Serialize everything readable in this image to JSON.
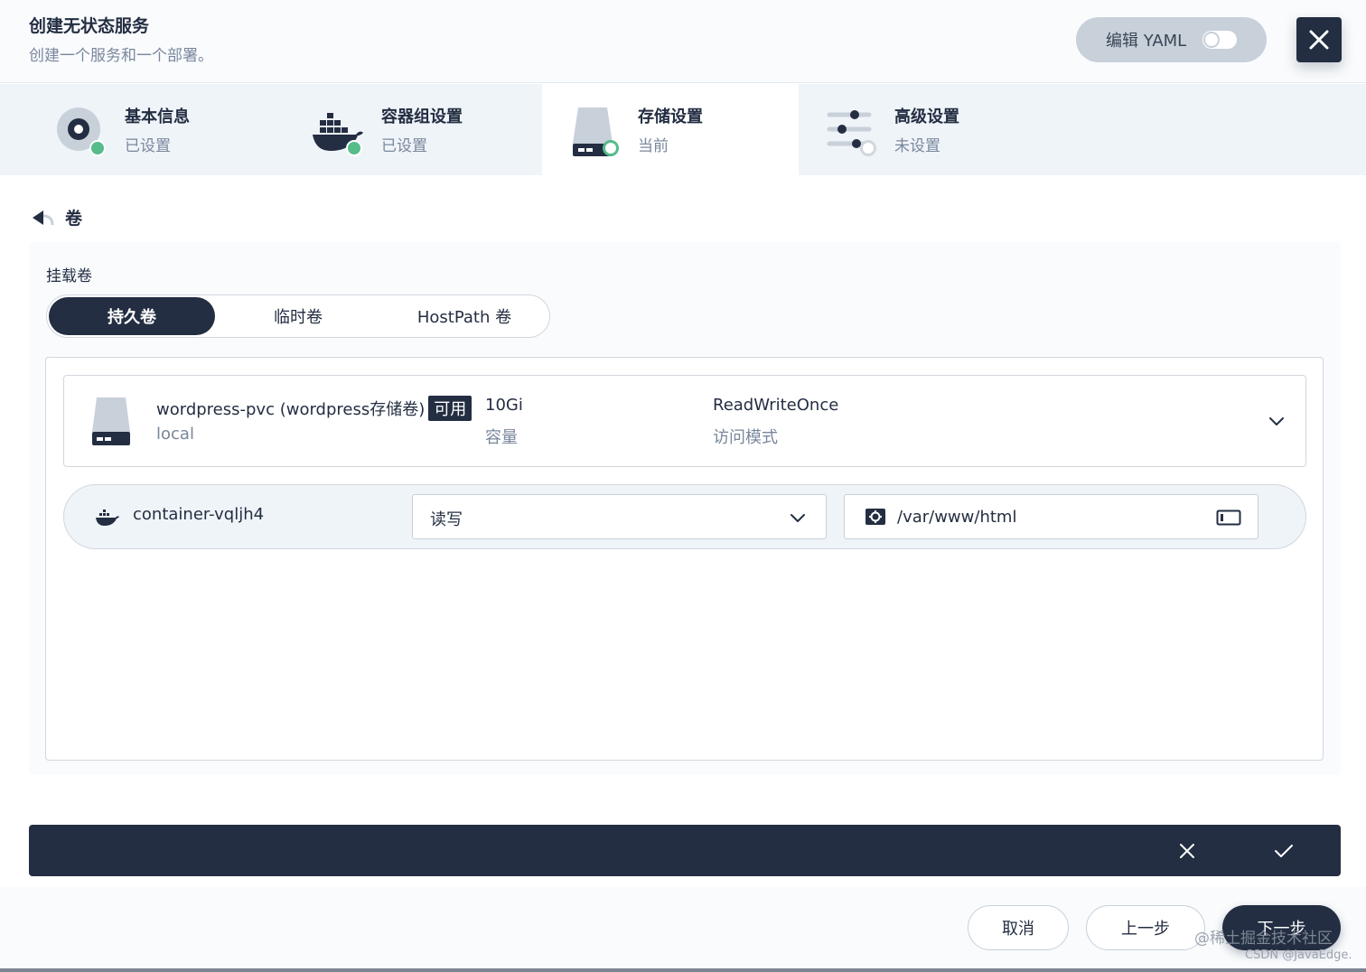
{
  "header": {
    "title": "创建无状态服务",
    "subtitle": "创建一个服务和一个部署。",
    "yaml_label": "编辑 YAML"
  },
  "steps": [
    {
      "title": "基本信息",
      "status": "已设置",
      "icon": "disc-icon"
    },
    {
      "title": "容器组设置",
      "status": "已设置",
      "icon": "docker-icon"
    },
    {
      "title": "存储设置",
      "status": "当前",
      "icon": "storage-icon"
    },
    {
      "title": "高级设置",
      "status": "未设置",
      "icon": "sliders-icon"
    }
  ],
  "back": {
    "label": "卷"
  },
  "mount": {
    "label": "挂载卷",
    "tabs": [
      "持久卷",
      "临时卷",
      "HostPath 卷"
    ],
    "active_tab": "持久卷"
  },
  "volume": {
    "name": "wordpress-pvc (wordpress存储卷)",
    "badge": "可用",
    "storage_class": "local",
    "capacity": "10Gi",
    "capacity_label": "容量",
    "access_mode": "ReadWriteOnce",
    "access_mode_label": "访问模式"
  },
  "mount_row": {
    "container": "container-vqljh4",
    "mode": "读写",
    "path": "/var/www/html"
  },
  "footer": {
    "cancel": "取消",
    "prev": "上一步",
    "next": "下一步"
  },
  "watermark": "@稀土掘金技术社区",
  "credit": "CSDN @JavaEdge.",
  "colors": {
    "primary_dark": "#242e42",
    "success_green": "#55bc8a",
    "muted_text": "#79879c",
    "border": "#d1d7df"
  }
}
